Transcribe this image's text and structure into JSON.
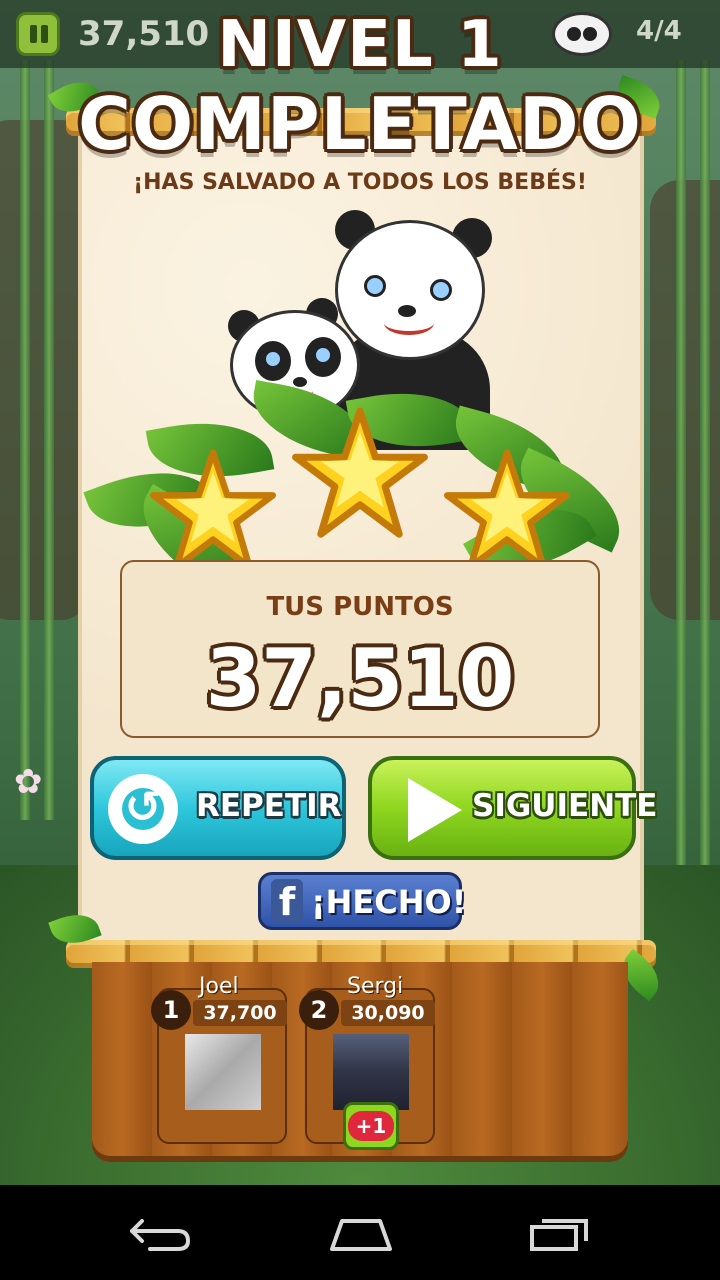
{
  "topbar": {
    "score": "37,510",
    "babies_count": "4/4"
  },
  "title": {
    "line1": "NIVEL 1",
    "line2": "COMPLETADO"
  },
  "subtitle": "¡HAS SALVADO A TODOS LOS BEBÉS!",
  "stars": {
    "earned": 3,
    "total": 3
  },
  "score": {
    "label": "TUS PUNTOS",
    "value": "37,510"
  },
  "buttons": {
    "repeat": "REPETIR",
    "next": "SIGUIENTE",
    "facebook": "¡HECHO!",
    "facebook_icon": "f"
  },
  "leaderboard": [
    {
      "rank": "1",
      "name": "Joel",
      "score": "37,700"
    },
    {
      "rank": "2",
      "name": "Sergi",
      "score": "30,090",
      "badge": "+1"
    }
  ],
  "colors": {
    "repeat_button": "#2ec7dc",
    "next_button": "#8fd61f",
    "facebook_button": "#3b5998",
    "title_outline": "#4b2a12",
    "star": "#ffd21f"
  }
}
